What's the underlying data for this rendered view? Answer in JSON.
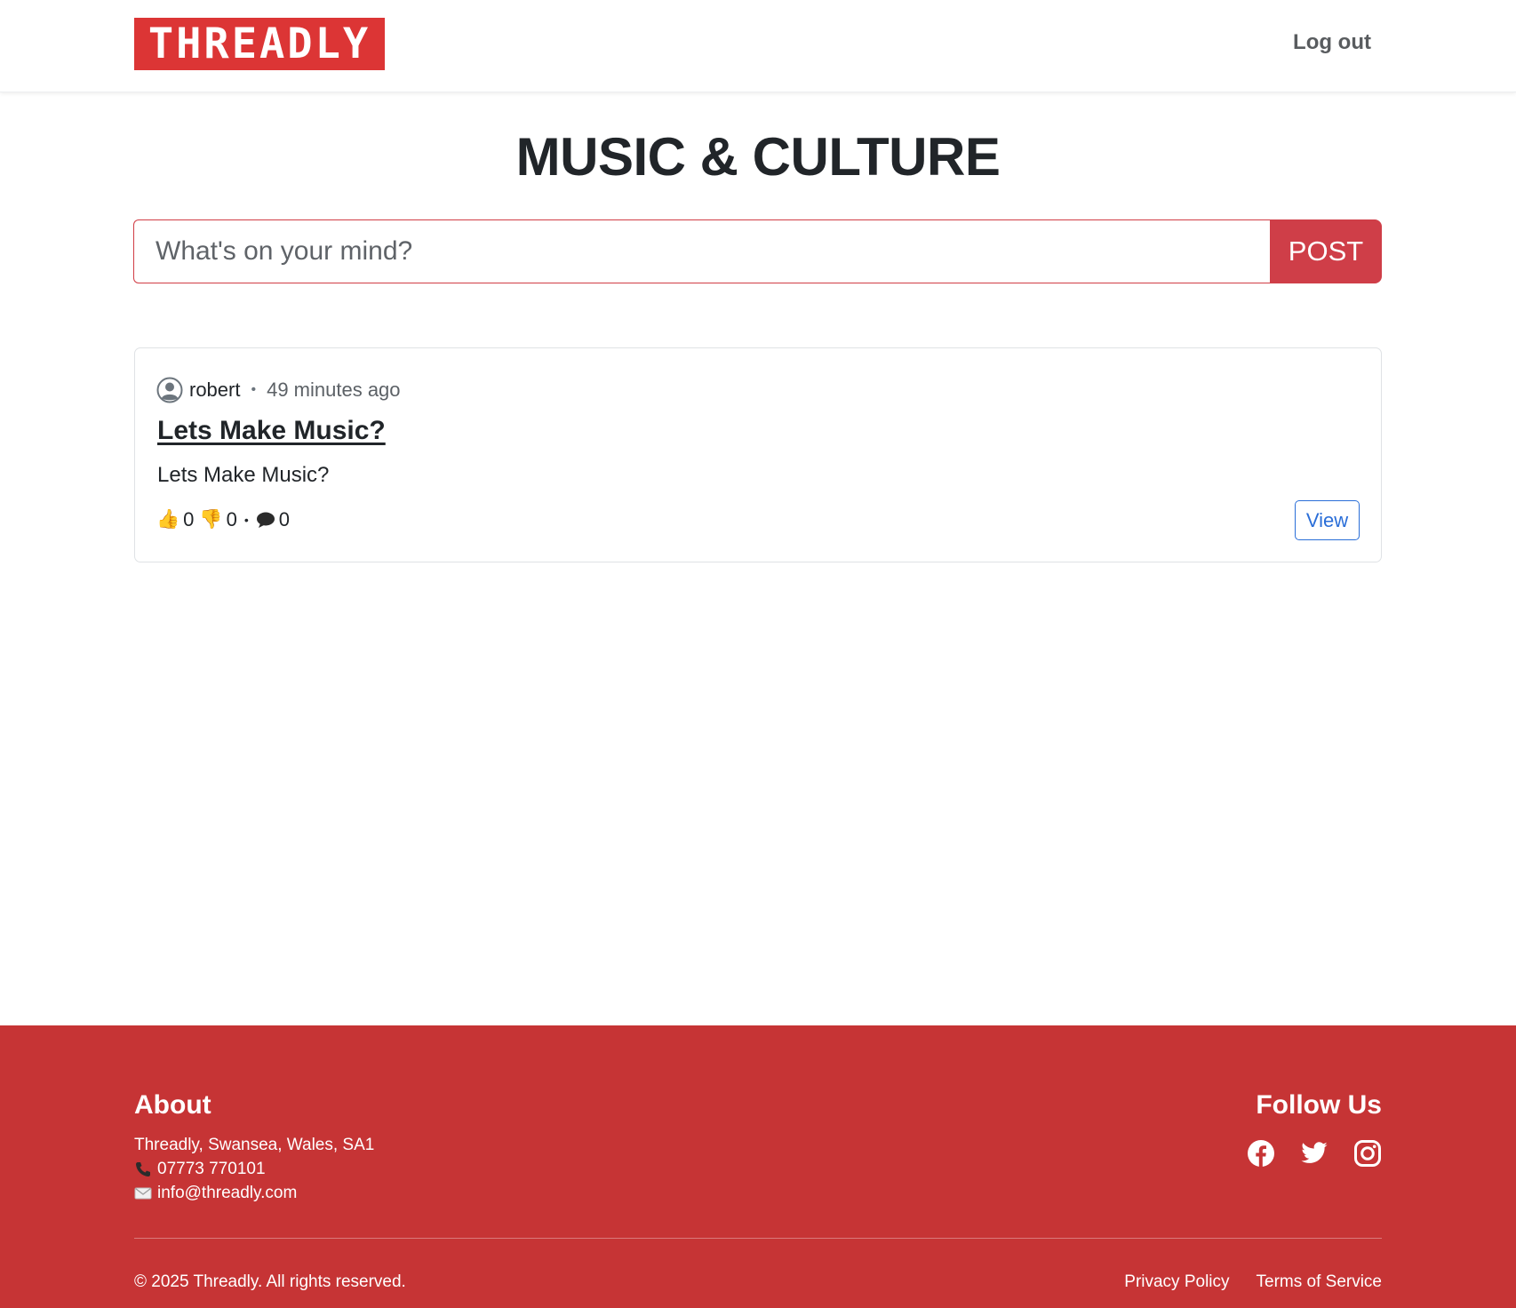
{
  "header": {
    "logo_text": "THREADLY",
    "logout_label": "Log out"
  },
  "page": {
    "title": "MUSIC & CULTURE"
  },
  "composer": {
    "placeholder": "What's on your mind?",
    "post_label": "POST"
  },
  "posts": [
    {
      "author": "robert",
      "time": "49 minutes ago",
      "title": "Lets Make Music?",
      "body": "Lets Make Music?",
      "likes": "0",
      "dislikes": "0",
      "comments": "0",
      "view_label": "View"
    }
  ],
  "footer": {
    "about_heading": "About",
    "address": "Threadly, Swansea, Wales, SA1",
    "phone": "07773 770101",
    "email": "info@threadly.com",
    "follow_heading": "Follow Us",
    "socials": [
      "facebook-icon",
      "twitter-icon",
      "instagram-icon"
    ],
    "copyright": "© 2025 Threadly. All rights reserved.",
    "privacy_label": "Privacy Policy",
    "terms_label": "Terms of Service"
  },
  "colors": {
    "brand_red": "#dc3535",
    "footer_red": "#c63435",
    "post_button": "#cf3e48",
    "link_blue": "#2a6ed8"
  }
}
